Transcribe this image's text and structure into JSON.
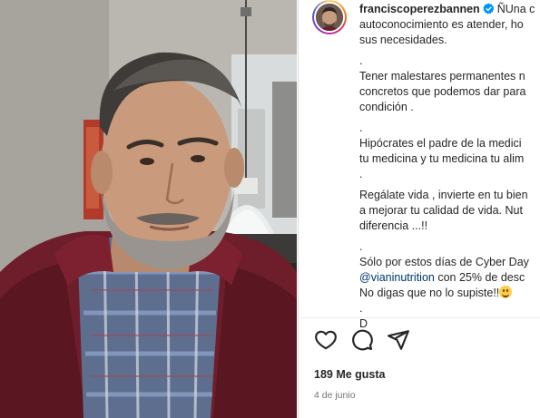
{
  "post": {
    "username": "franciscoperezbannen",
    "verified": true,
    "caption_lines": [
      "ÑUna c",
      "autoconocimiento es atender, ho",
      "sus necesidades.",
      ".",
      "Tener malestares permanentes n",
      "concretos que podemos dar para",
      "condición .",
      ".",
      "Hipócrates el padre de la medici",
      "tu medicina y tu medicina tu alim",
      ".",
      "Regálate vida , invierte en tu bien",
      "a mejorar tu calidad de vida. Nut",
      "diferencia ...!!",
      ".",
      "Sólo por estos días de Cyber Day",
      "con 25% de desc",
      "No digas que no lo supiste!!",
      ".",
      "D"
    ],
    "mention": "@vianinutrition",
    "likes": "189 Me gusta",
    "date": "4 de junio"
  },
  "icons": {
    "like": "heart-icon",
    "comment": "comment-icon",
    "share": "share-icon",
    "verified": "verified-badge-icon",
    "emoji": "grinning-face-emoji"
  },
  "colors": {
    "text": "#262626",
    "secondary": "#737373",
    "mention": "#00376b",
    "verified": "#0095f6"
  }
}
